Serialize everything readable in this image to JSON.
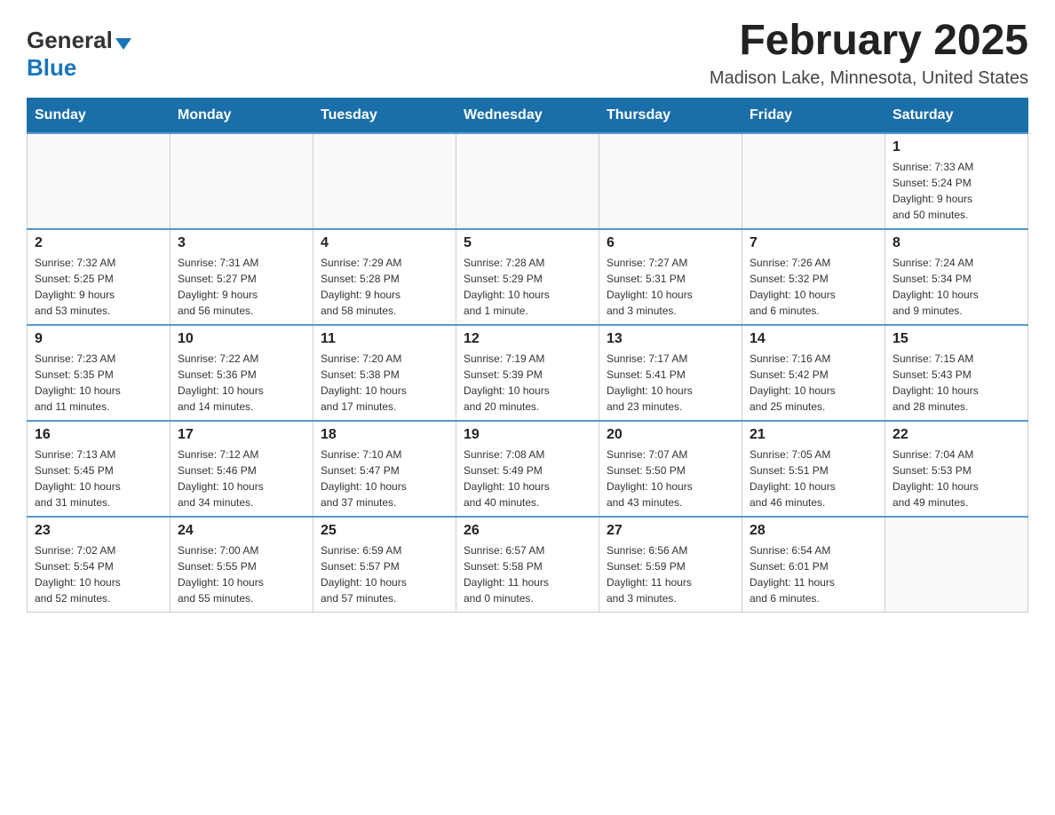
{
  "header": {
    "logo_general": "General",
    "logo_blue": "Blue",
    "month_title": "February 2025",
    "location": "Madison Lake, Minnesota, United States"
  },
  "weekdays": [
    "Sunday",
    "Monday",
    "Tuesday",
    "Wednesday",
    "Thursday",
    "Friday",
    "Saturday"
  ],
  "weeks": [
    [
      {
        "day": "",
        "info": ""
      },
      {
        "day": "",
        "info": ""
      },
      {
        "day": "",
        "info": ""
      },
      {
        "day": "",
        "info": ""
      },
      {
        "day": "",
        "info": ""
      },
      {
        "day": "",
        "info": ""
      },
      {
        "day": "1",
        "info": "Sunrise: 7:33 AM\nSunset: 5:24 PM\nDaylight: 9 hours\nand 50 minutes."
      }
    ],
    [
      {
        "day": "2",
        "info": "Sunrise: 7:32 AM\nSunset: 5:25 PM\nDaylight: 9 hours\nand 53 minutes."
      },
      {
        "day": "3",
        "info": "Sunrise: 7:31 AM\nSunset: 5:27 PM\nDaylight: 9 hours\nand 56 minutes."
      },
      {
        "day": "4",
        "info": "Sunrise: 7:29 AM\nSunset: 5:28 PM\nDaylight: 9 hours\nand 58 minutes."
      },
      {
        "day": "5",
        "info": "Sunrise: 7:28 AM\nSunset: 5:29 PM\nDaylight: 10 hours\nand 1 minute."
      },
      {
        "day": "6",
        "info": "Sunrise: 7:27 AM\nSunset: 5:31 PM\nDaylight: 10 hours\nand 3 minutes."
      },
      {
        "day": "7",
        "info": "Sunrise: 7:26 AM\nSunset: 5:32 PM\nDaylight: 10 hours\nand 6 minutes."
      },
      {
        "day": "8",
        "info": "Sunrise: 7:24 AM\nSunset: 5:34 PM\nDaylight: 10 hours\nand 9 minutes."
      }
    ],
    [
      {
        "day": "9",
        "info": "Sunrise: 7:23 AM\nSunset: 5:35 PM\nDaylight: 10 hours\nand 11 minutes."
      },
      {
        "day": "10",
        "info": "Sunrise: 7:22 AM\nSunset: 5:36 PM\nDaylight: 10 hours\nand 14 minutes."
      },
      {
        "day": "11",
        "info": "Sunrise: 7:20 AM\nSunset: 5:38 PM\nDaylight: 10 hours\nand 17 minutes."
      },
      {
        "day": "12",
        "info": "Sunrise: 7:19 AM\nSunset: 5:39 PM\nDaylight: 10 hours\nand 20 minutes."
      },
      {
        "day": "13",
        "info": "Sunrise: 7:17 AM\nSunset: 5:41 PM\nDaylight: 10 hours\nand 23 minutes."
      },
      {
        "day": "14",
        "info": "Sunrise: 7:16 AM\nSunset: 5:42 PM\nDaylight: 10 hours\nand 25 minutes."
      },
      {
        "day": "15",
        "info": "Sunrise: 7:15 AM\nSunset: 5:43 PM\nDaylight: 10 hours\nand 28 minutes."
      }
    ],
    [
      {
        "day": "16",
        "info": "Sunrise: 7:13 AM\nSunset: 5:45 PM\nDaylight: 10 hours\nand 31 minutes."
      },
      {
        "day": "17",
        "info": "Sunrise: 7:12 AM\nSunset: 5:46 PM\nDaylight: 10 hours\nand 34 minutes."
      },
      {
        "day": "18",
        "info": "Sunrise: 7:10 AM\nSunset: 5:47 PM\nDaylight: 10 hours\nand 37 minutes."
      },
      {
        "day": "19",
        "info": "Sunrise: 7:08 AM\nSunset: 5:49 PM\nDaylight: 10 hours\nand 40 minutes."
      },
      {
        "day": "20",
        "info": "Sunrise: 7:07 AM\nSunset: 5:50 PM\nDaylight: 10 hours\nand 43 minutes."
      },
      {
        "day": "21",
        "info": "Sunrise: 7:05 AM\nSunset: 5:51 PM\nDaylight: 10 hours\nand 46 minutes."
      },
      {
        "day": "22",
        "info": "Sunrise: 7:04 AM\nSunset: 5:53 PM\nDaylight: 10 hours\nand 49 minutes."
      }
    ],
    [
      {
        "day": "23",
        "info": "Sunrise: 7:02 AM\nSunset: 5:54 PM\nDaylight: 10 hours\nand 52 minutes."
      },
      {
        "day": "24",
        "info": "Sunrise: 7:00 AM\nSunset: 5:55 PM\nDaylight: 10 hours\nand 55 minutes."
      },
      {
        "day": "25",
        "info": "Sunrise: 6:59 AM\nSunset: 5:57 PM\nDaylight: 10 hours\nand 57 minutes."
      },
      {
        "day": "26",
        "info": "Sunrise: 6:57 AM\nSunset: 5:58 PM\nDaylight: 11 hours\nand 0 minutes."
      },
      {
        "day": "27",
        "info": "Sunrise: 6:56 AM\nSunset: 5:59 PM\nDaylight: 11 hours\nand 3 minutes."
      },
      {
        "day": "28",
        "info": "Sunrise: 6:54 AM\nSunset: 6:01 PM\nDaylight: 11 hours\nand 6 minutes."
      },
      {
        "day": "",
        "info": ""
      }
    ]
  ]
}
